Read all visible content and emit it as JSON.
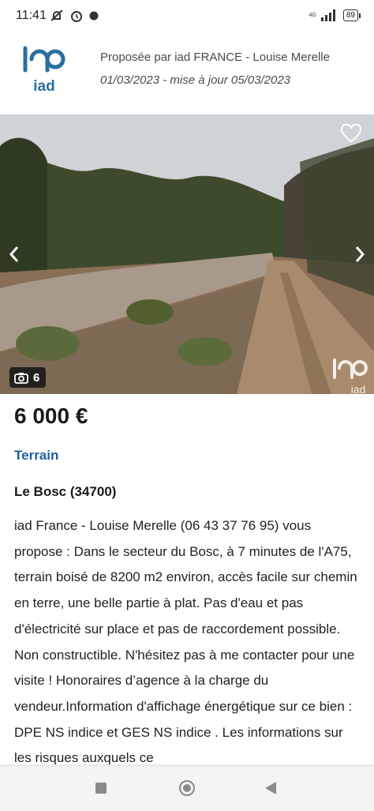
{
  "status": {
    "time": "11:41",
    "battery": "89",
    "network": "4G"
  },
  "agency": {
    "logo_text": "iad",
    "proposed_by": "Proposée par iad FRANCE - Louise Merelle",
    "dates": "01/03/2023 - mise à jour 05/03/2023"
  },
  "gallery": {
    "photo_count": "6",
    "watermark_text": "iad"
  },
  "listing": {
    "price": "6 000 €",
    "type": "Terrain",
    "location": "Le Bosc (34700)",
    "description": "iad France - Louise Merelle (06 43 37 76 95) vous propose : Dans le secteur du Bosc, à 7 minutes de l'A75, terrain boisé de 8200 m2 environ, accès facile sur chemin en terre, une belle partie à plat. Pas d'eau et pas d'électricité sur place et pas de raccordement possible. Non constructible. N'hésitez pas à me contacter pour une visite ! Honoraires d’agence à la charge du vendeur.Information d'affichage énergétique sur ce bien : DPE NS indice et GES NS indice . Les informations sur les risques auxquels ce"
  },
  "colors": {
    "accent_blue": "#1f5ea3",
    "logo_teal": "#2a6f9e"
  }
}
